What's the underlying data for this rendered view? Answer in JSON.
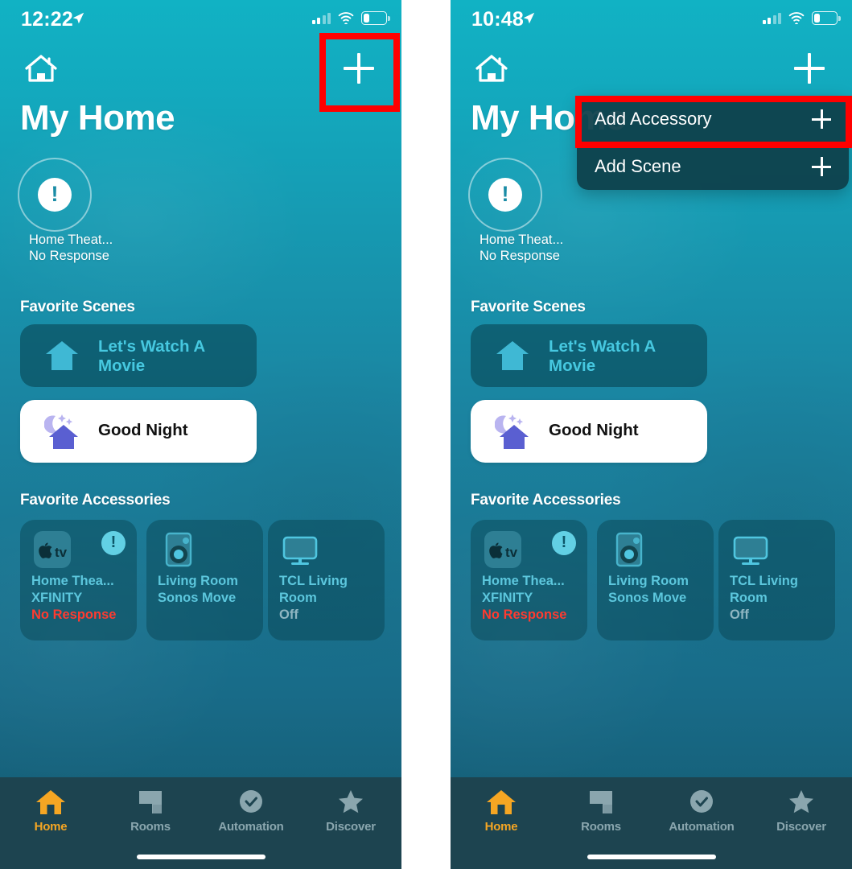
{
  "meta": {
    "app": "Apple Home",
    "accent_orange": "#f5a623",
    "accent_teal": "#5cc7dd",
    "error_red": "#ff3b30",
    "highlight_red": "#ff0000",
    "tabbar_bg": "#1d4450"
  },
  "left": {
    "status_bar": {
      "time": "12:22",
      "location_icon": "location-arrow-icon",
      "signal_icon": "cellular-bars-icon",
      "wifi_icon": "wifi-icon",
      "battery_icon": "battery-low-icon"
    },
    "nav": {
      "home_icon": "house-icon",
      "add_icon": "plus-icon"
    },
    "title": "My Home",
    "status": {
      "icon": "exclamation-circle-icon",
      "line1": "Home Theat...",
      "line2": "No Response"
    },
    "sections": {
      "scenes": "Favorite Scenes",
      "accessories": "Favorite Accessories"
    },
    "scenes": [
      {
        "name": "Let's Watch A Movie",
        "icon": "house-scene-icon",
        "style": "dark"
      },
      {
        "name": "Good Night",
        "icon": "moon-house-icon",
        "style": "white"
      }
    ],
    "accessories": [
      {
        "icon": "apple-tv-icon",
        "badge": "exclamation-badge-icon",
        "name": "Home Thea...",
        "sub": "XFINITY",
        "state": "No Response",
        "state_kind": "error"
      },
      {
        "icon": "speaker-icon",
        "badge": null,
        "name": "Living Room",
        "sub": "Sonos Move",
        "state": "",
        "state_kind": "none"
      },
      {
        "icon": "tv-icon",
        "badge": null,
        "name": "TCL Living",
        "sub": "Room",
        "state": "Off",
        "state_kind": "off"
      }
    ],
    "tabs": [
      {
        "label": "Home",
        "icon": "house-icon",
        "active": true
      },
      {
        "label": "Rooms",
        "icon": "rooms-icon",
        "active": false
      },
      {
        "label": "Automation",
        "icon": "clock-icon",
        "active": false
      },
      {
        "label": "Discover",
        "icon": "star-icon",
        "active": false
      }
    ]
  },
  "right": {
    "status_bar": {
      "time": "10:48",
      "location_icon": "location-arrow-icon",
      "signal_icon": "cellular-bars-icon",
      "wifi_icon": "wifi-icon",
      "battery_icon": "battery-low-icon"
    },
    "nav": {
      "home_icon": "house-icon",
      "add_icon": "plus-icon"
    },
    "title": "My Home",
    "status": {
      "icon": "exclamation-circle-icon",
      "line1": "Home Theat...",
      "line2": "No Response"
    },
    "sections": {
      "scenes": "Favorite Scenes",
      "accessories": "Favorite Accessories"
    },
    "scenes": [
      {
        "name": "Let's Watch A Movie",
        "icon": "house-scene-icon",
        "style": "dark"
      },
      {
        "name": "Good Night",
        "icon": "moon-house-icon",
        "style": "white"
      }
    ],
    "accessories": [
      {
        "icon": "apple-tv-icon",
        "badge": "exclamation-badge-icon",
        "name": "Home Thea...",
        "sub": "XFINITY",
        "state": "No Response",
        "state_kind": "error"
      },
      {
        "icon": "speaker-icon",
        "badge": null,
        "name": "Living Room",
        "sub": "Sonos Move",
        "state": "",
        "state_kind": "none"
      },
      {
        "icon": "tv-icon",
        "badge": null,
        "name": "TCL Living",
        "sub": "Room",
        "state": "Off",
        "state_kind": "off"
      }
    ],
    "menu": [
      {
        "label": "Add Accessory",
        "icon": "plus-icon"
      },
      {
        "label": "Add Scene",
        "icon": "plus-icon"
      }
    ],
    "tabs": [
      {
        "label": "Home",
        "icon": "house-icon",
        "active": true
      },
      {
        "label": "Rooms",
        "icon": "rooms-icon",
        "active": false
      },
      {
        "label": "Automation",
        "icon": "clock-icon",
        "active": false
      },
      {
        "label": "Discover",
        "icon": "star-icon",
        "active": false
      }
    ]
  }
}
